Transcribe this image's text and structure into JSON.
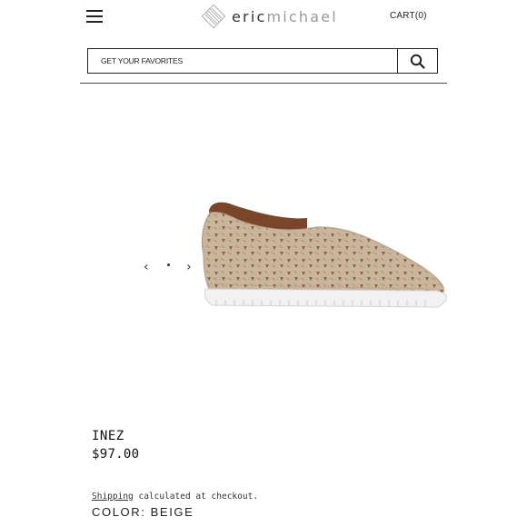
{
  "header": {
    "logo": {
      "part1": "eric",
      "part2": "michael",
      "icon": "diamond-stripes-logo-icon"
    },
    "cart_label": "CART(0)",
    "menu_icon": "hamburger-menu-icon"
  },
  "search": {
    "placeholder": "GET YOUR FAVORITES",
    "icon": "search-icon"
  },
  "gallery": {
    "prev_icon": "chevron-left-icon",
    "next_icon": "chevron-right-icon",
    "prev_glyph": "‹",
    "next_glyph": "›",
    "image": "beige-perforated-slip-on-shoe"
  },
  "product": {
    "name": "INEZ",
    "price": "$97.00",
    "shipping_link": "Shipping",
    "shipping_text": " calculated at checkout.",
    "color_label": "COLOR: BEIGE"
  },
  "colors": {
    "shoe_upper": "#c9b49c",
    "shoe_lining": "#7a4528",
    "sole": "#f1f1f1"
  }
}
